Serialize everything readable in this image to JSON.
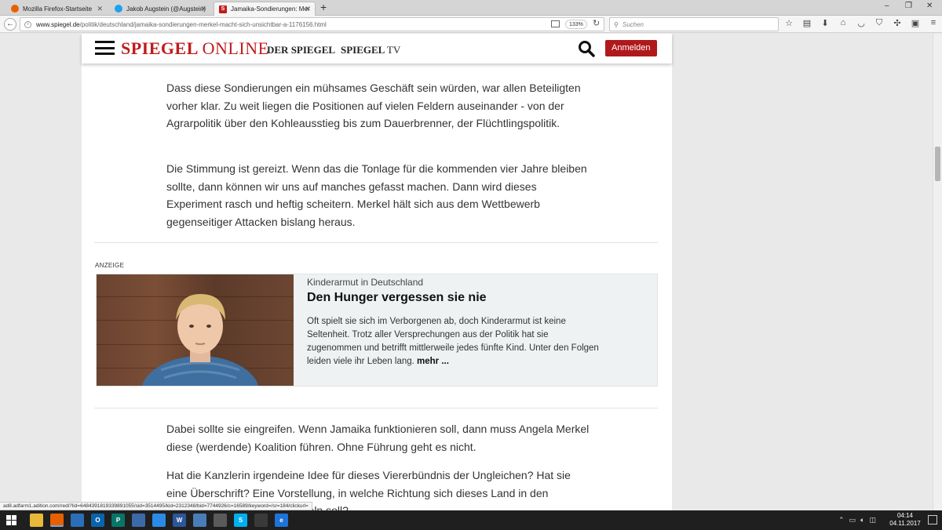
{
  "browser": {
    "tabs": [
      {
        "label": "Mozilla Firefox-Startseite",
        "active": false
      },
      {
        "label": "Jakob Augstein (@Augstein)",
        "active": false
      },
      {
        "label": "Jamaika-Sondierungen: Mer",
        "active": true
      }
    ],
    "new_tab_label": "+",
    "window_controls": {
      "minimize": "–",
      "maximize": "❐",
      "close": "✕"
    },
    "url": {
      "host": "www.spiegel.de",
      "path": "/politik/deutschland/jamaika-sondierungen-merkel-macht-sich-unsichtbar-a-1176156.html"
    },
    "zoom_level": "133%",
    "search_placeholder": "Suchen"
  },
  "site_header": {
    "logo_spiegel": "SPIEGEL",
    "logo_online": "ONLINE",
    "der_spiegel": "DER SPIEGEL",
    "spiegel_tv_spiegel": "SPIEGEL",
    "spiegel_tv_tv": "TV",
    "login_label": "Anmelden",
    "brand_color": "#b0191c"
  },
  "article": {
    "paragraphs_top": [
      "Dass diese Sondierungen ein mühsames Geschäft sein würden, war allen Beteiligten vorher klar. Zu weit liegen die Positionen auf vielen Feldern auseinander - von der Agrarpolitik über den Kohleausstieg bis zum Dauerbrenner, der Flüchtlingspolitik.",
      "Die Stimmung ist gereizt. Wenn das die Tonlage für die kommenden vier Jahre bleiben sollte, dann können wir uns auf manches gefasst machen. Dann wird dieses Experiment rasch und heftig scheitern. Merkel hält sich aus dem Wettbewerb gegenseitiger Attacken bislang heraus."
    ],
    "paragraphs_bottom": [
      "Dabei sollte sie eingreifen. Wenn Jamaika funktionieren soll, dann muss Angela Merkel diese (werdende) Koalition führen. Ohne Führung geht es nicht.",
      "Hat die Kanzlerin irgendeine Idee für dieses Viererbündnis der Ungleichen? Hat sie eine Überschrift? Eine Vorstellung, in welche Richtung sich dieses Land in den nächsten vier Jahren entwickeln soll?"
    ]
  },
  "ad": {
    "label": "ANZEIGE",
    "kicker": "Kinderarmut in Deutschland",
    "title": "Den Hunger vergessen sie nie",
    "text": "Oft spielt sie sich im Verborgenen ab, doch Kinderarmut ist keine Seltenheit. Trotz aller Versprechungen aus der Politik hat sie zugenommen und betrifft mittlerweile jedes fünfte Kind. Unter den Folgen leiden viele ihr Leben lang.",
    "more_label": "mehr ..."
  },
  "status_bar_url": "ad8.adfarm1.adition.com/redi?lid=6484391819339891055/sid=3514495/kid=2312348/bid=7744926/c=16589/keyword=/sr=184/clickurl=",
  "taskbar": {
    "time": "04:14",
    "date": "04.11.2017",
    "apps": [
      {
        "name": "file-explorer",
        "label": "",
        "color": "#e8b83a"
      },
      {
        "name": "firefox",
        "label": "",
        "color": "#e66000"
      },
      {
        "name": "calendar",
        "label": "",
        "color": "#2a6fb8"
      },
      {
        "name": "outlook",
        "label": "O",
        "color": "#0a64ad"
      },
      {
        "name": "publisher",
        "label": "P",
        "color": "#077568"
      },
      {
        "name": "gallery",
        "label": "",
        "color": "#3c6aa8"
      },
      {
        "name": "dropbox",
        "label": "",
        "color": "#2b8ae5"
      },
      {
        "name": "word",
        "label": "W",
        "color": "#2b579a"
      },
      {
        "name": "globe-app",
        "label": "",
        "color": "#4a7db8"
      },
      {
        "name": "pin-app",
        "label": "",
        "color": "#5a5a5a"
      },
      {
        "name": "skype",
        "label": "S",
        "color": "#00aff0"
      },
      {
        "name": "media-app",
        "label": "",
        "color": "#3a3a3a"
      },
      {
        "name": "edge",
        "label": "e",
        "color": "#1e73d9"
      }
    ]
  }
}
